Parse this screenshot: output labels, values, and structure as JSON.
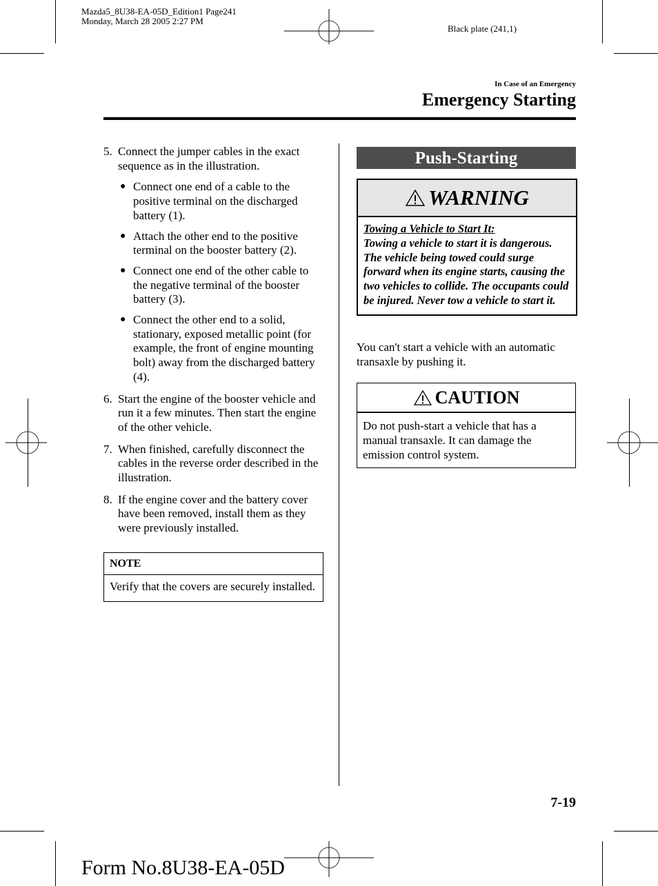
{
  "print_meta": {
    "file_line": "Mazda5_8U38-EA-05D_Edition1 Page241",
    "date_line": "Monday, March 28 2005 2:27 PM",
    "plate": "Black plate (241,1)"
  },
  "header": {
    "section": "In Case of an Emergency",
    "title": "Emergency Starting"
  },
  "left_column": {
    "steps": [
      {
        "num": "5.",
        "text": "Connect the jumper cables in the exact sequence as in the illustration.",
        "bullets": [
          "Connect one end of a cable to the positive terminal on the discharged battery (1).",
          "Attach the other end to the positive terminal on the booster battery (2).",
          "Connect one end of the other cable to the negative terminal of the booster battery (3).",
          "Connect the other end to a solid, stationary, exposed metallic point (for example, the front of engine mounting bolt) away from the discharged battery (4)."
        ]
      },
      {
        "num": "6.",
        "text": "Start the engine of the booster vehicle and run it a few minutes. Then start the engine of the other vehicle."
      },
      {
        "num": "7.",
        "text": "When finished, carefully disconnect the cables in the reverse order described in the illustration."
      },
      {
        "num": "8.",
        "text": "If the engine cover and the battery cover have been removed, install them as they were previously installed."
      }
    ],
    "note": {
      "heading": "NOTE",
      "body": "Verify that the covers are securely installed."
    }
  },
  "right_column": {
    "section_heading": "Push-Starting",
    "warning": {
      "icon": "warning-triangle-icon",
      "title": "WARNING",
      "subtitle": "Towing a Vehicle to Start It:",
      "body": "Towing a vehicle to start it is dangerous. The vehicle being towed could surge forward when its engine starts, causing the two vehicles to collide. The occupants could be injured. Never tow a vehicle to start it."
    },
    "paragraph": "You can't start a vehicle with an automatic transaxle by pushing it.",
    "caution": {
      "icon": "warning-triangle-icon",
      "title": "CAUTION",
      "body": "Do not push-start a vehicle that has a manual transaxle. It can damage the emission control system."
    }
  },
  "footer": {
    "page_number": "7-19",
    "form_number": "Form No.8U38-EA-05D"
  },
  "colors": {
    "section_heading_bg": "#4d4d4d",
    "warning_header_bg": "#e6e6e6"
  }
}
